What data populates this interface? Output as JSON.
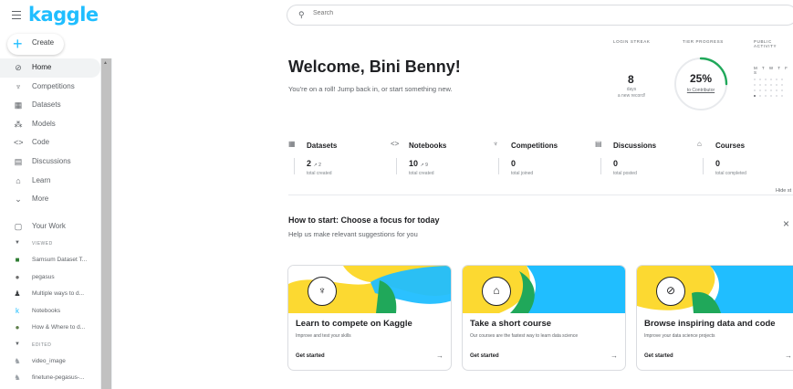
{
  "brand": {
    "logo": "kaggle"
  },
  "create": {
    "label": "Create"
  },
  "nav": {
    "items": [
      {
        "label": "Home",
        "icon": "compass-icon",
        "glyph": "⊘",
        "active": true
      },
      {
        "label": "Competitions",
        "icon": "trophy-icon",
        "glyph": "♆"
      },
      {
        "label": "Datasets",
        "icon": "table-icon",
        "glyph": "▦"
      },
      {
        "label": "Models",
        "icon": "models-icon",
        "glyph": "⁂"
      },
      {
        "label": "Code",
        "icon": "code-icon",
        "glyph": "<>"
      },
      {
        "label": "Discussions",
        "icon": "discussions-icon",
        "glyph": "▤"
      },
      {
        "label": "Learn",
        "icon": "mortarboard-icon",
        "glyph": "⌂"
      },
      {
        "label": "More",
        "icon": "chevron-down-icon",
        "glyph": "⌄"
      }
    ],
    "your_work": {
      "label": "Your Work",
      "icon": "your-work-icon",
      "glyph": "▢"
    }
  },
  "viewed": {
    "header": "VIEWED",
    "items": [
      {
        "label": "Samsum Dataset T...",
        "icon": "dataset-thumb-icon",
        "glyph": "■",
        "color": "#2e7d32"
      },
      {
        "label": "pegasus",
        "icon": "model-thumb-icon",
        "glyph": "●",
        "color": "#6d6d6d"
      },
      {
        "label": "Multiple ways to d...",
        "icon": "user-avatar-icon",
        "glyph": "♟",
        "color": "#3c4043"
      },
      {
        "label": "Notebooks",
        "icon": "kaggle-k-icon",
        "glyph": "k",
        "color": "#20beff"
      },
      {
        "label": "How & Where to d...",
        "icon": "notebook-thumb-icon",
        "glyph": "●",
        "color": "#5e7e4a"
      }
    ]
  },
  "edited": {
    "header": "EDITED",
    "items": [
      {
        "label": "video_image",
        "icon": "notebook-avatar-icon",
        "glyph": "♞",
        "color": "#9aa0a6"
      },
      {
        "label": "finetune-pegasus-...",
        "icon": "notebook-avatar-icon",
        "glyph": "♞",
        "color": "#9aa0a6"
      }
    ]
  },
  "search": {
    "placeholder": "Search"
  },
  "welcome": {
    "title": "Welcome, Bini Benny!",
    "subtitle": "You're on a roll! Jump back in, or start something new."
  },
  "streak": {
    "header": "LOGIN STREAK",
    "value": "8",
    "unit": "days",
    "note": "a new record!"
  },
  "tier": {
    "header": "TIER PROGRESS",
    "percent": "25%",
    "progress": 0.25,
    "link": "to Contributor",
    "color": "#20a85a"
  },
  "activity": {
    "header": "PUBLIC ACTIVITY",
    "days": "M T W T F S"
  },
  "categories": [
    {
      "label": "Datasets",
      "icon": "datasets-icon",
      "glyph": "▦",
      "value": "2",
      "delta": "↗ 2",
      "sub": "total created"
    },
    {
      "label": "Notebooks",
      "icon": "notebooks-icon",
      "glyph": "<>",
      "value": "10",
      "delta": "↗ 9",
      "sub": "total created"
    },
    {
      "label": "Competitions",
      "icon": "competitions-icon",
      "glyph": "♆",
      "value": "0",
      "delta": "",
      "sub": "total joined"
    },
    {
      "label": "Discussions",
      "icon": "discussions-icon",
      "glyph": "▤",
      "value": "0",
      "delta": "",
      "sub": "total posted"
    },
    {
      "label": "Courses",
      "icon": "courses-icon",
      "glyph": "⌂",
      "value": "0",
      "delta": "",
      "sub": "total completed"
    }
  ],
  "hide_stats": "Hide st",
  "how": {
    "title": "How to start: Choose a focus for today",
    "subtitle": "Help us make relevant suggestions for you",
    "close": "×"
  },
  "cards": [
    {
      "title": "Learn to compete on Kaggle",
      "desc": "Improve and test your skills",
      "cta": "Get started",
      "arrow": "→",
      "icon": "trophy-icon",
      "glyph": "♆"
    },
    {
      "title": "Take a short course",
      "desc": "Our courses are the fastest way to learn data science",
      "cta": "Get started",
      "arrow": "→",
      "icon": "mortarboard-icon",
      "glyph": "⌂"
    },
    {
      "title": "Browse inspiring data and code",
      "desc": "Improve your data science projects",
      "cta": "Get started",
      "arrow": "→",
      "icon": "compass-icon",
      "glyph": "⊘"
    }
  ],
  "colors": {
    "yellow": "#fcd931",
    "blue": "#20beff",
    "green": "#20a85a",
    "brand": "#20beff"
  }
}
